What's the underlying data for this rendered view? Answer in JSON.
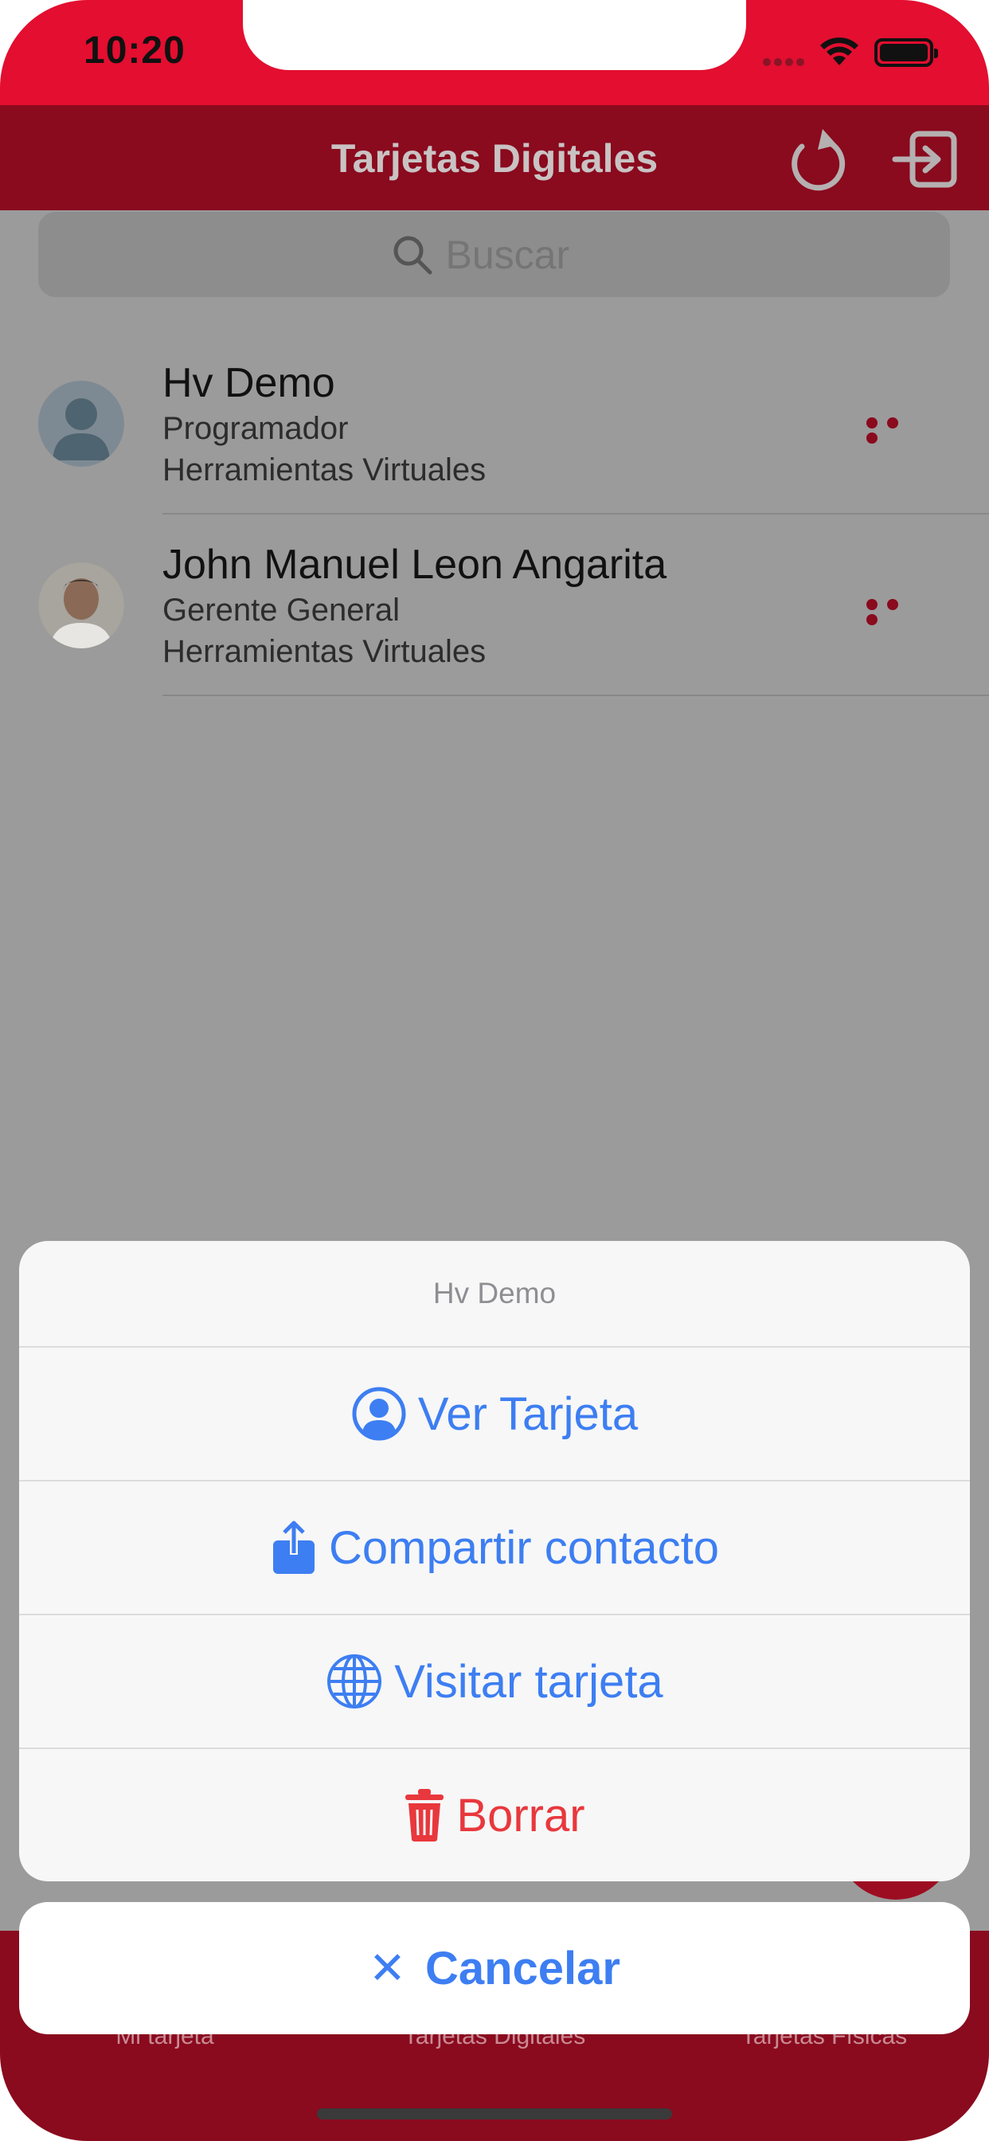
{
  "status_bar": {
    "time": "10:20"
  },
  "nav": {
    "title": "Tarjetas Digitales",
    "refresh_icon": "refresh-icon",
    "exit_icon": "logout-icon"
  },
  "search": {
    "placeholder": "Buscar"
  },
  "cards": [
    {
      "name": "Hv Demo",
      "role": "Programador",
      "company": "Herramientas Virtuales"
    },
    {
      "name": "John Manuel Leon Angarita",
      "role": "Gerente General",
      "company": "Herramientas Virtuales"
    }
  ],
  "tabs": [
    {
      "label": "Mi tarjeta"
    },
    {
      "label": "Tarjetas Digitales"
    },
    {
      "label": "Tarjetas Físicas"
    }
  ],
  "action_sheet": {
    "title": "Hv Demo",
    "items": [
      {
        "label": "Ver Tarjeta",
        "icon": "person-circle-icon"
      },
      {
        "label": "Compartir contacto",
        "icon": "share-icon"
      },
      {
        "label": "Visitar tarjeta",
        "icon": "globe-icon"
      },
      {
        "label": "Borrar",
        "icon": "trash-icon"
      }
    ],
    "cancel_label": "Cancelar"
  },
  "colors": {
    "status_red": "#e30e30",
    "nav_dark_red": "#8a0a1e",
    "action_blue": "#3d7ef2",
    "destructive_red": "#e8383d"
  }
}
